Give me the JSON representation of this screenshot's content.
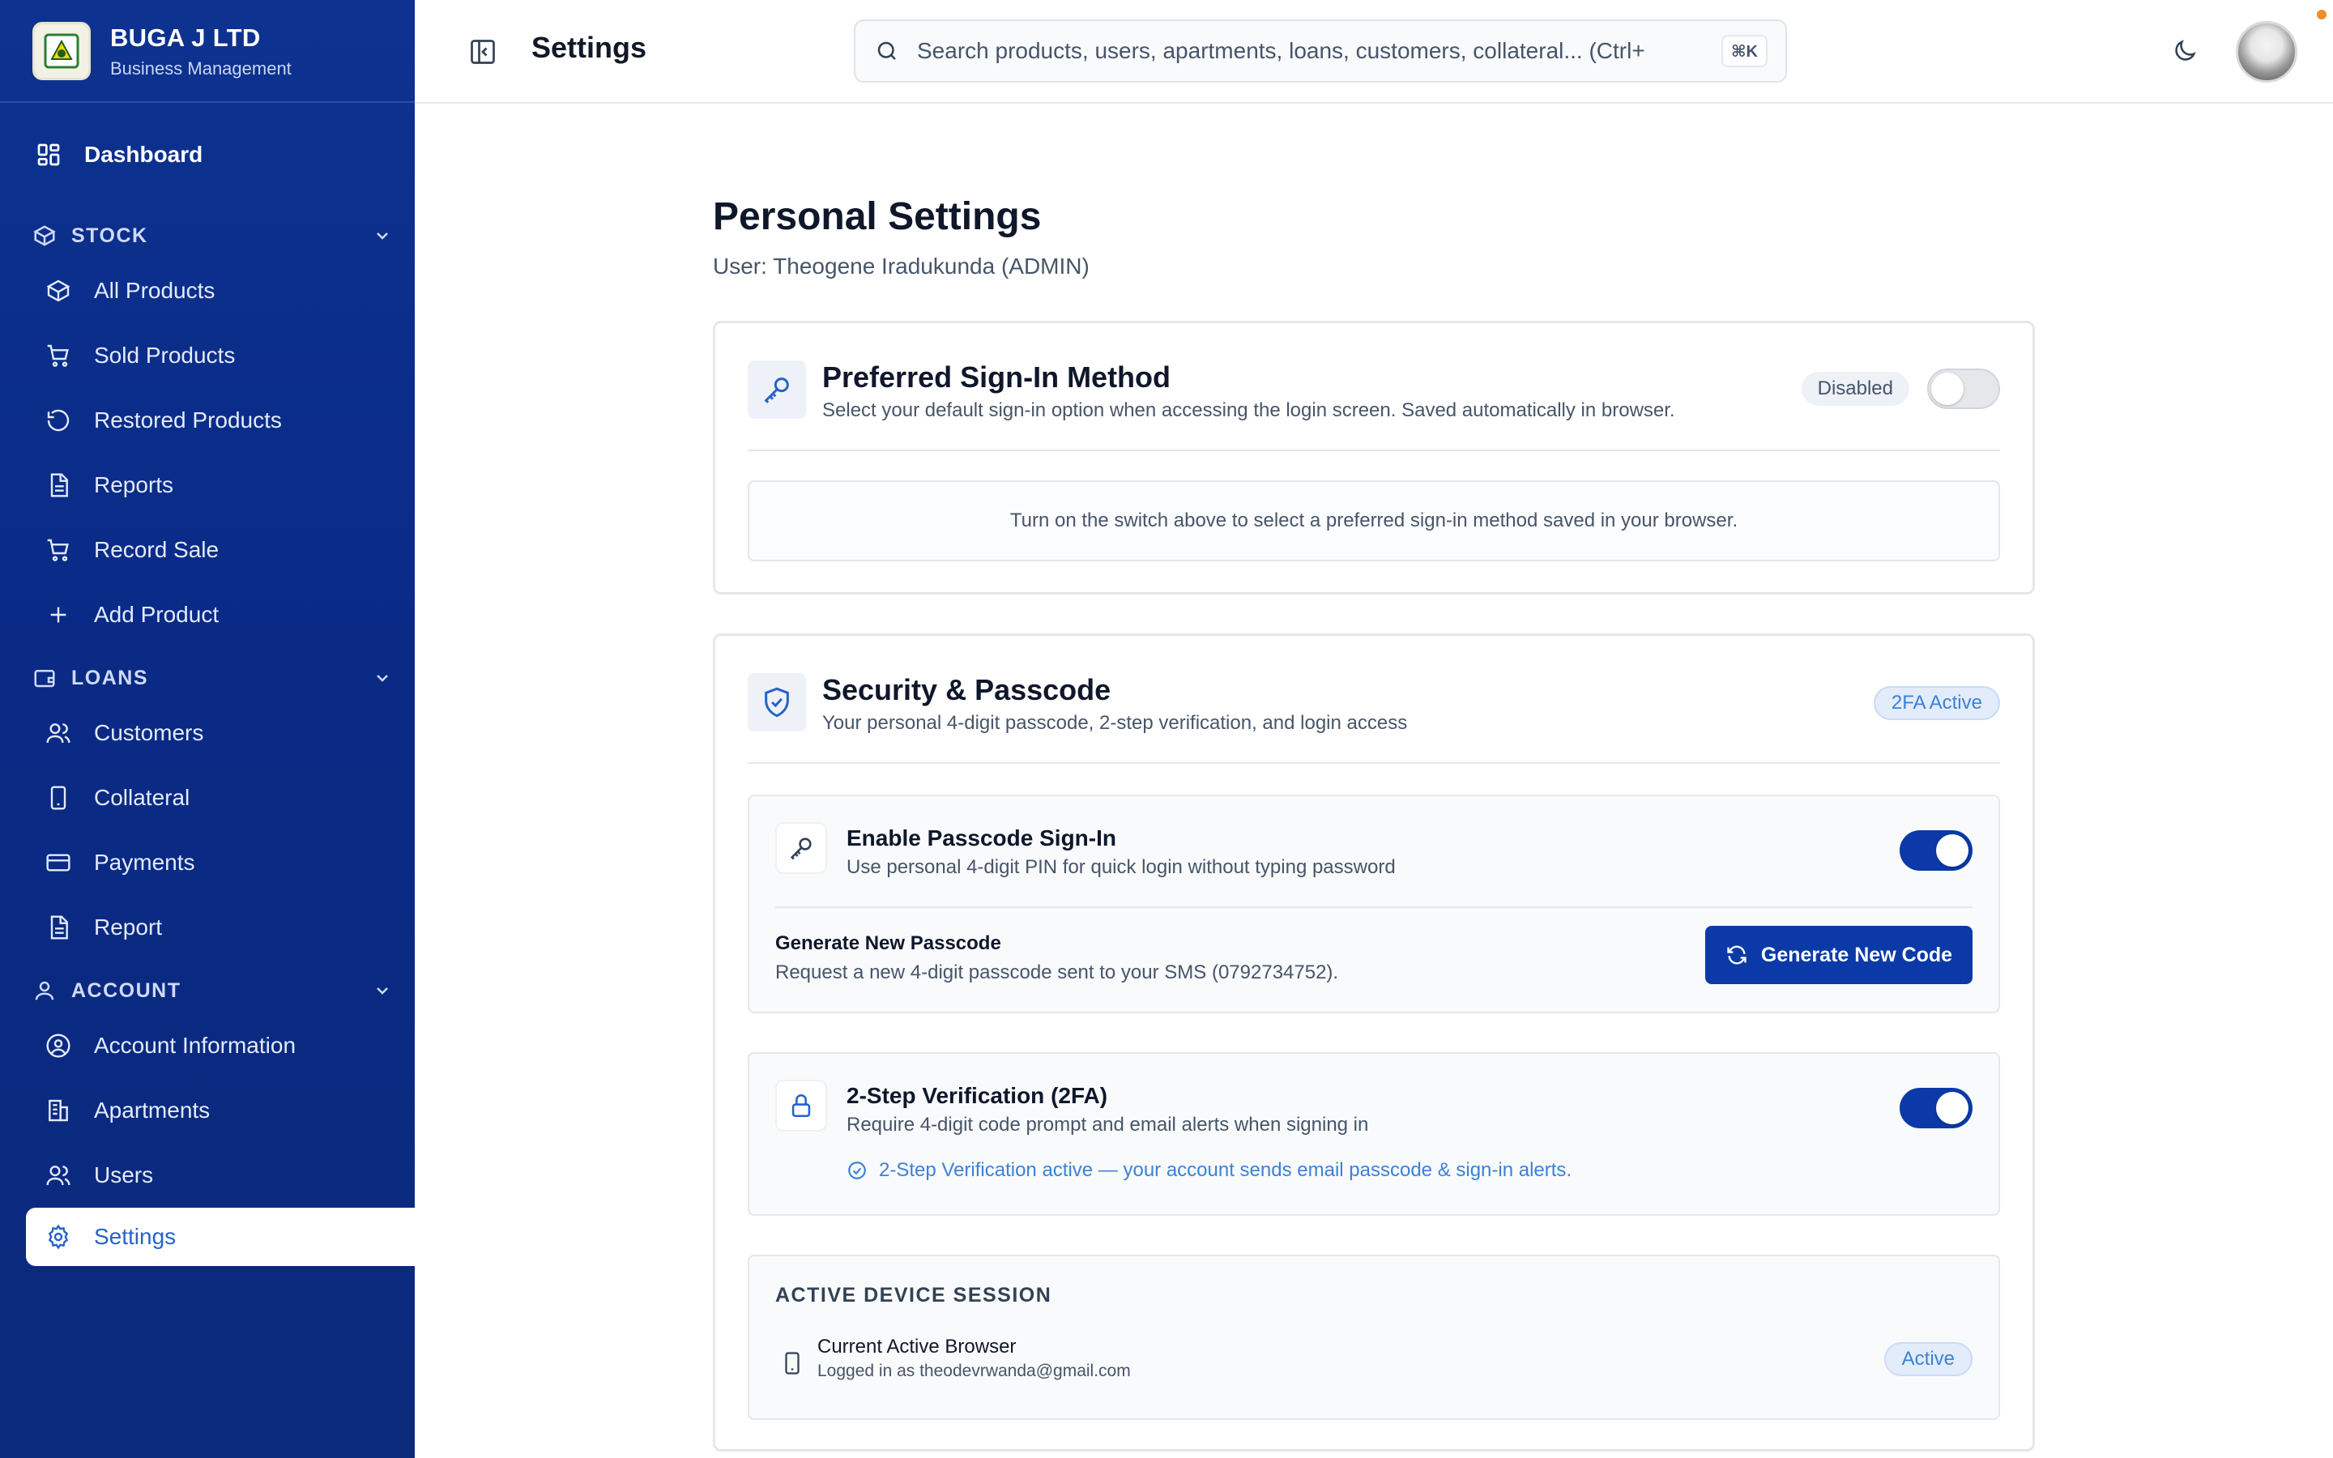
{
  "brand": {
    "name": "BUGA J LTD",
    "subtitle": "Business Management"
  },
  "sidebar": {
    "dashboard": {
      "label": "Dashboard",
      "icon": "dashboard-icon"
    },
    "groups": [
      {
        "label": "STOCK",
        "icon": "box-icon",
        "items": [
          {
            "label": "All Products",
            "icon": "box-icon"
          },
          {
            "label": "Sold Products",
            "icon": "cart-icon"
          },
          {
            "label": "Restored Products",
            "icon": "restore-icon"
          },
          {
            "label": "Reports",
            "icon": "document-icon"
          },
          {
            "label": "Record Sale",
            "icon": "cart-icon"
          },
          {
            "label": "Add Product",
            "icon": "plus-icon"
          }
        ]
      },
      {
        "label": "LOANS",
        "icon": "wallet-icon",
        "items": [
          {
            "label": "Customers",
            "icon": "users-icon"
          },
          {
            "label": "Collateral",
            "icon": "phone-icon"
          },
          {
            "label": "Payments",
            "icon": "card-icon"
          },
          {
            "label": "Report",
            "icon": "document-icon"
          }
        ]
      },
      {
        "label": "ACCOUNT",
        "icon": "user-icon",
        "items": [
          {
            "label": "Account Information",
            "icon": "user-circle-icon"
          },
          {
            "label": "Apartments",
            "icon": "building-icon"
          },
          {
            "label": "Users",
            "icon": "users-icon"
          },
          {
            "label": "Settings",
            "icon": "gear-icon",
            "active": true
          }
        ]
      }
    ]
  },
  "header": {
    "title": "Settings",
    "search_placeholder": "Search products, users, apartments, loans, customers, collateral... (Ctrl+",
    "shortcut": "⌘K"
  },
  "main": {
    "title": "Personal Settings",
    "user_line": "User: Theogene Iradukunda (ADMIN)",
    "signin": {
      "title": "Preferred Sign-In Method",
      "description": "Select your default sign-in option when accessing the login screen. Saved automatically in browser.",
      "status": "Disabled",
      "enabled": false,
      "hint": "Turn on the switch above to select a preferred sign-in method saved in your browser."
    },
    "security": {
      "title": "Security & Passcode",
      "description": "Your personal 4-digit passcode, 2-step verification, and login access",
      "badge": "2FA Active",
      "passcode": {
        "title": "Enable Passcode Sign-In",
        "description": "Use personal 4-digit PIN for quick login without typing password",
        "enabled": true,
        "generate_title": "Generate New Passcode",
        "generate_desc": "Request a new 4-digit passcode sent to your SMS (0792734752).",
        "button": "Generate New Code"
      },
      "twofa": {
        "title": "2-Step Verification (2FA)",
        "description": "Require 4-digit code prompt and email alerts when signing in",
        "enabled": true,
        "status": "2-Step Verification active — your account sends email passcode & sign-in alerts."
      },
      "session": {
        "label": "ACTIVE DEVICE SESSION",
        "device": "Current Active Browser",
        "logged_in": "Logged in as theodevrwanda@gmail.com",
        "badge": "Active"
      }
    }
  },
  "colors": {
    "sidebar": "#0a2a86",
    "primary": "#0b3aa8",
    "accent": "#3b82d6",
    "active_text": "#2563c9"
  }
}
